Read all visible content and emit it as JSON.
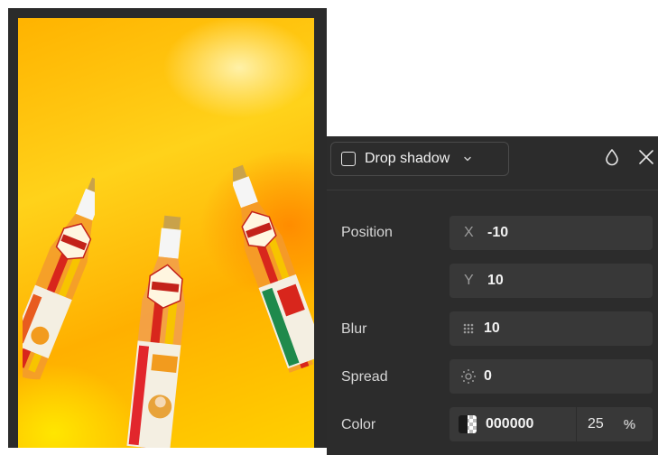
{
  "effect": {
    "type_label": "Drop shadow",
    "enabled": false
  },
  "position": {
    "label": "Position",
    "x_prefix": "X",
    "x_value": "-10",
    "y_prefix": "Y",
    "y_value": "10"
  },
  "blur": {
    "label": "Blur",
    "value": "10",
    "icon": "blur-icon"
  },
  "spread": {
    "label": "Spread",
    "value": "0",
    "icon": "spread-icon"
  },
  "color": {
    "label": "Color",
    "hex": "000000",
    "opacity": "25",
    "opacity_unit": "%"
  },
  "header_icons": [
    "opacity-drop-icon",
    "close-icon"
  ],
  "colors": {
    "panel_bg": "#2c2c2c",
    "field_bg": "#383838",
    "artboard_orange": "#ff8c00",
    "artboard_yellow": "#ffd21a"
  },
  "canvas": {
    "image_description_icon": "lemonade-bottles-image"
  }
}
